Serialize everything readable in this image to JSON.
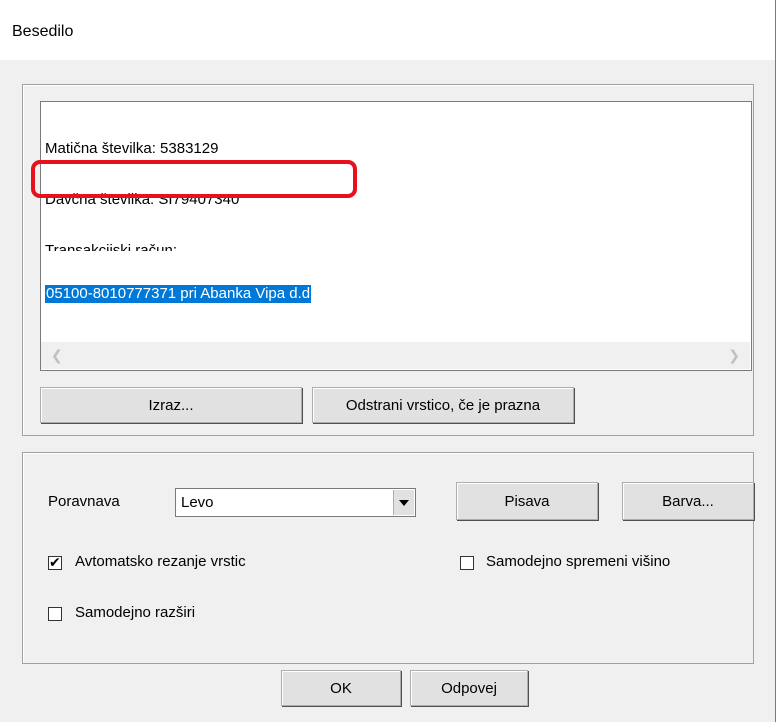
{
  "window": {
    "title": "Besedilo"
  },
  "editor": {
    "lines": [
      "Matična številka: 5383129",
      "Davčna številka: SI79407340",
      "Transakcijski račun:"
    ],
    "selected_line": "05100-8010777371 pri Abanka Vipa d.d"
  },
  "buttons": {
    "expression": "Izraz...",
    "remove_empty": "Odstrani vrstico, če je prazna",
    "font": "Pisava",
    "color": "Barva...",
    "ok": "OK",
    "cancel": "Odpovej"
  },
  "alignment": {
    "label": "Poravnava",
    "value": "Levo"
  },
  "checkboxes": {
    "auto_wrap": {
      "label": "Avtomatsko rezanje vrstic",
      "checked": true
    },
    "auto_height": {
      "label": "Samodejno spremeni višino",
      "checked": false
    },
    "auto_expand": {
      "label": "Samodejno razširi",
      "checked": false
    }
  },
  "colors": {
    "selection": "#0078d7",
    "highlight": "#e8101a",
    "dialog_bg": "#f0f0f0"
  }
}
